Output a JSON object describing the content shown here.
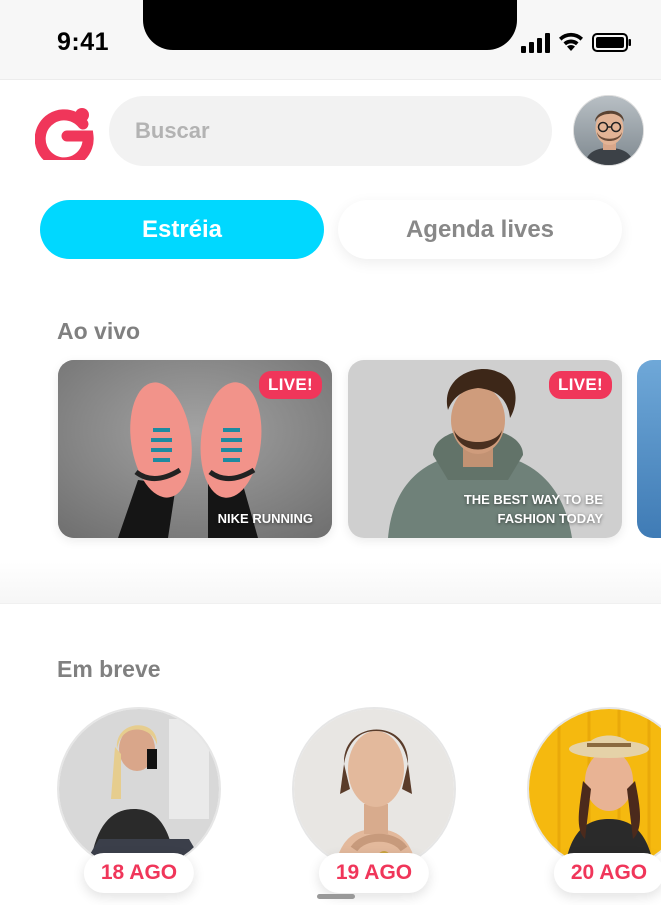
{
  "status_bar": {
    "time": "9:41"
  },
  "search": {
    "placeholder": "Buscar"
  },
  "tabs": [
    {
      "label": "Estréia",
      "active": true
    },
    {
      "label": "Agenda lives",
      "active": false
    }
  ],
  "live_section": {
    "title": "Ao vivo",
    "cards": [
      {
        "badge": "LIVE!",
        "caption": "NIKE RUNNING"
      },
      {
        "badge": "LIVE!",
        "caption": "THE BEST WAY TO BE FASHION TODAY"
      }
    ]
  },
  "upcoming_section": {
    "title": "Em breve",
    "items": [
      {
        "date": "18 AGO"
      },
      {
        "date": "19 AGO"
      },
      {
        "date": "20 AGO"
      }
    ]
  },
  "colors": {
    "accent": "#00d8ff",
    "brand": "#f0365a",
    "muted_text": "#808080"
  }
}
